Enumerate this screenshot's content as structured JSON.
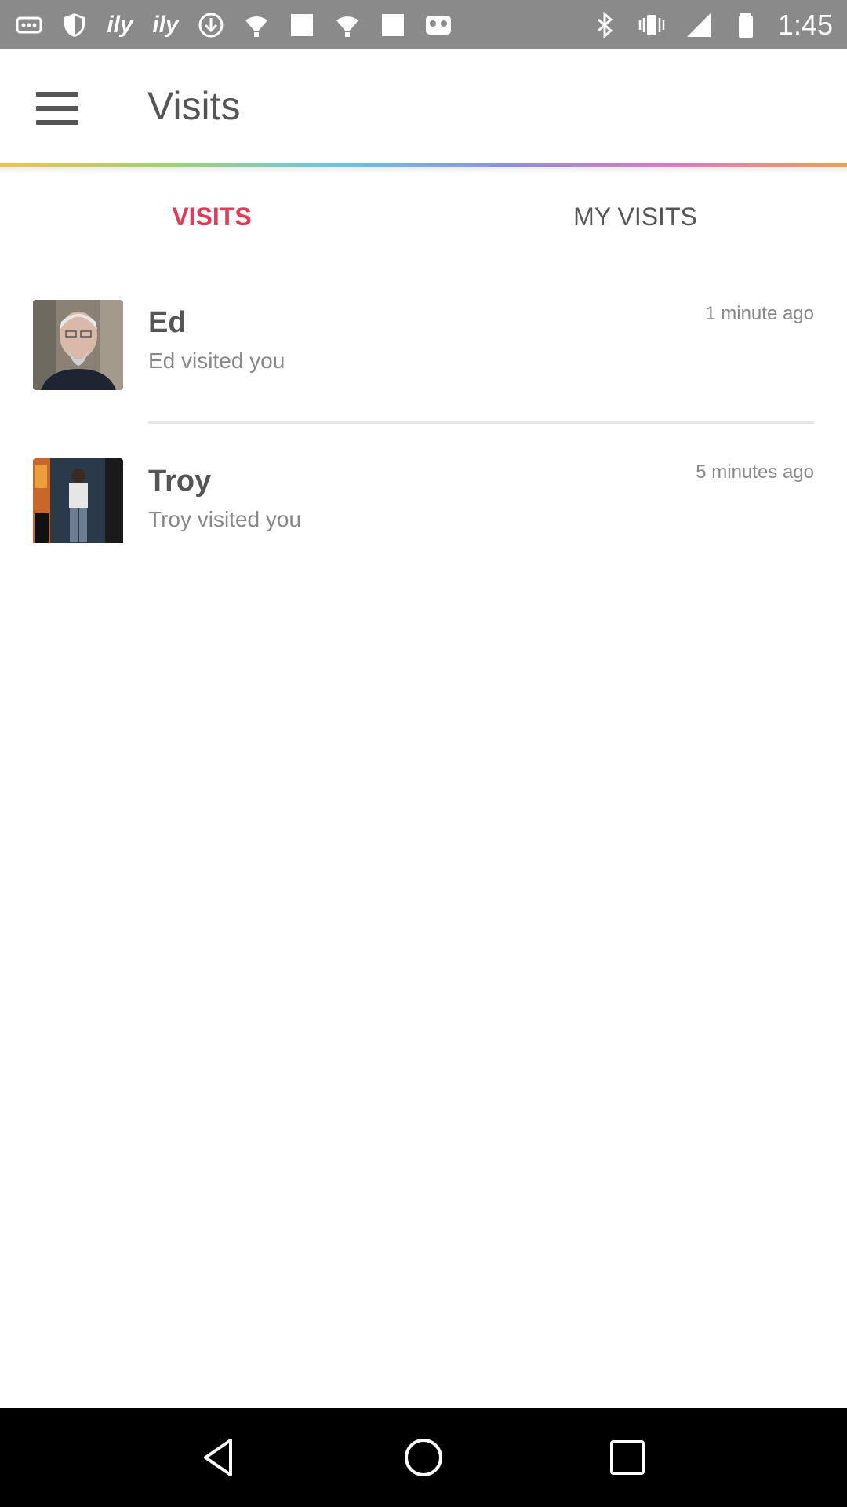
{
  "status_bar": {
    "time": "1:45",
    "left_icons": [
      "more-icon",
      "shield-icon",
      "ily-icon",
      "ily-icon",
      "download-icon",
      "lightbulb-icon",
      "square-icon",
      "lightbulb-icon",
      "square-icon",
      "gamepad-icon"
    ],
    "ily_text": "ily",
    "right_icons": [
      "bluetooth-icon",
      "vibrate-icon",
      "signal-icon",
      "battery-icon"
    ]
  },
  "app_bar": {
    "title": "Visits",
    "menu_icon": "hamburger-menu-icon"
  },
  "tabs": [
    {
      "label": "VISITS",
      "active": true
    },
    {
      "label": "MY VISITS",
      "active": false
    }
  ],
  "visits": [
    {
      "name": "Ed",
      "message": "Ed visited you",
      "time": "1 minute ago"
    },
    {
      "name": "Troy",
      "message": "Troy visited you",
      "time": "5 minutes ago"
    }
  ],
  "colors": {
    "accent": "#e53a57",
    "status_bar": "#8a8a8a",
    "text_primary": "#555555",
    "text_secondary": "#888888"
  }
}
